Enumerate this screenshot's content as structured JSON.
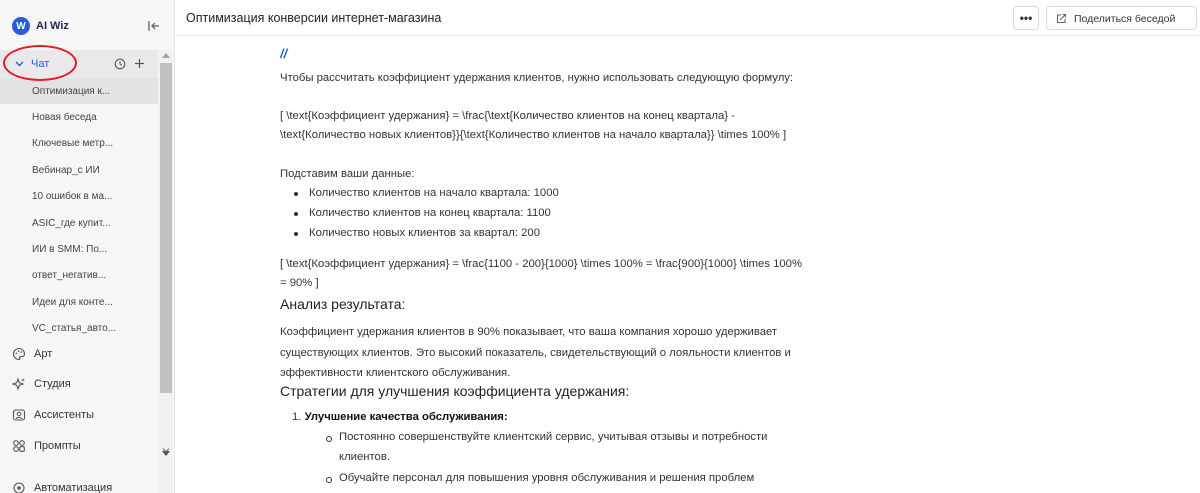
{
  "brand": {
    "name": "AI Wiz",
    "logo_letter": "W"
  },
  "sidebar": {
    "chat_label": "Чат",
    "conversations": [
      "Оптимизация к...",
      "Новая беседа",
      "Ключевые метр...",
      "Вебинар_с ИИ",
      "10 ошибок в ма...",
      "ASIC_где купит...",
      "ИИ в SMM: По...",
      "ответ_негатив...",
      "Идеи для конте...",
      "VC_статья_авто..."
    ],
    "nav": [
      {
        "label": "Арт",
        "icon": "palette-icon"
      },
      {
        "label": "Студия",
        "icon": "sparkle-icon"
      },
      {
        "label": "Ассистенты",
        "icon": "assistant-icon"
      },
      {
        "label": "Промпты",
        "icon": "grid-icon"
      },
      {
        "label": "Автоматизация",
        "icon": "automation-icon"
      }
    ]
  },
  "header": {
    "title": "Оптимизация конверсии интернет-магазина",
    "more_label": "•••",
    "share_label": "Поделиться беседой"
  },
  "content": {
    "slash": "//",
    "intro": "Чтобы рассчитать коэффициент удержания клиентов, нужно использовать следующую формулу:",
    "formula": "[ \\text{Коэффициент удержания} = \\frac{\\text{Количество клиентов на конец квартала} - \\text{Количество новых клиентов}}{\\text{Количество клиентов на начало квартала}} \\times 100% ]",
    "substitute": "Подставим ваши данные:",
    "data_items": [
      "Количество клиентов на начало квартала: 1000",
      "Количество клиентов на конец квартала: 1100",
      "Количество новых клиентов за квартал: 200"
    ],
    "calc": "[ \\text{Коэффициент удержания} = \\frac{1100 - 200}{1000} \\times 100% = \\frac{900}{1000} \\times 100% = 90% ]",
    "analysis_heading": "Анализ результата:",
    "analysis_text": "Коэффициент удержания клиентов в 90% показывает, что ваша компания хорошо удерживает существующих клиентов. Это высокий показатель, свидетельствующий о лояльности клиентов и эффективности клиентского обслуживания.",
    "strategies_heading": "Стратегии для улучшения коэффициента удержания:",
    "strategy_number": "1.",
    "strategy_title": "Улучшение качества обслуживания:",
    "strategy_items": [
      "Постоянно совершенствуйте клиентский сервис, учитывая отзывы и потребности клиентов.",
      "Обучайте персонал для повышения уровня обслуживания и решения проблем"
    ]
  },
  "colors": {
    "accent": "#2a5bd7",
    "annotation": "#e31b23"
  }
}
